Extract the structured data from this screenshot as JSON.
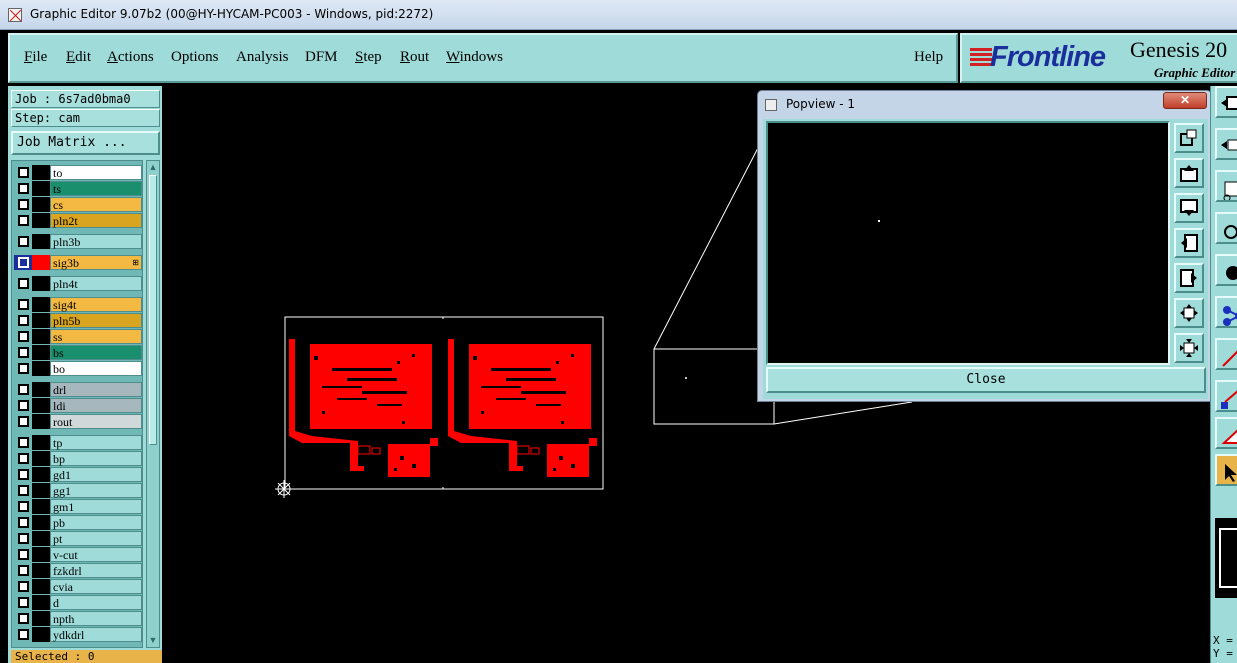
{
  "window": {
    "title": "Graphic Editor 9.07b2 (00@HY-HYCAM-PC003 - Windows, pid:2272)"
  },
  "menu": {
    "file": "File",
    "edit": "Edit",
    "actions": "Actions",
    "options": "Options",
    "analysis": "Analysis",
    "dfm": "DFM",
    "step": "Step",
    "rout": "Rout",
    "windows": "Windows",
    "help": "Help"
  },
  "brand": {
    "logo": "Frontline",
    "product": "Genesis 20",
    "subtitle": "Graphic Editor"
  },
  "left_panel": {
    "job": "Job : 6s7ad0bma0",
    "step": "Step: cam",
    "job_matrix": "Job Matrix ...",
    "selected": "Selected : 0"
  },
  "layers": [
    {
      "name": "to",
      "color": "#ffffff"
    },
    {
      "name": "ts",
      "color": "#1a8f6e"
    },
    {
      "name": "cs",
      "color": "#f4b942"
    },
    {
      "name": "pln2t",
      "color": "#d9a521"
    },
    {
      "name": "pln3b",
      "color": "#9fdbd9"
    },
    {
      "name": "sig3b",
      "color": "#f4b942",
      "work": true
    },
    {
      "name": "pln4t",
      "color": "#9fdbd9"
    },
    {
      "name": "sig4t",
      "color": "#f4b942"
    },
    {
      "name": "pln5b",
      "color": "#d9a521"
    },
    {
      "name": "ss",
      "color": "#f4b942"
    },
    {
      "name": "bs",
      "color": "#1a8f6e"
    },
    {
      "name": "bo",
      "color": "#ffffff"
    },
    {
      "name": "drl",
      "color": "#a6b7bd"
    },
    {
      "name": "ldi",
      "color": "#a6b7bd"
    },
    {
      "name": "rout",
      "color": "#d0d8da"
    },
    {
      "name": "tp",
      "color": "#9fdbd9"
    },
    {
      "name": "bp",
      "color": "#9fdbd9"
    },
    {
      "name": "gd1",
      "color": "#9fdbd9"
    },
    {
      "name": "gg1",
      "color": "#9fdbd9"
    },
    {
      "name": "gm1",
      "color": "#9fdbd9"
    },
    {
      "name": "pb",
      "color": "#9fdbd9"
    },
    {
      "name": "pt",
      "color": "#9fdbd9"
    },
    {
      "name": "v-cut",
      "color": "#9fdbd9"
    },
    {
      "name": "fzkdrl",
      "color": "#9fdbd9"
    },
    {
      "name": "cvia",
      "color": "#9fdbd9"
    },
    {
      "name": "d",
      "color": "#9fdbd9"
    },
    {
      "name": "npth",
      "color": "#9fdbd9"
    },
    {
      "name": "ydkdrl",
      "color": "#9fdbd9"
    }
  ],
  "popview": {
    "title": "Popview - 1",
    "close_label": "Close",
    "x_glyph": "✕"
  },
  "coords": {
    "x": "X =",
    "y": "Y ="
  },
  "colors": {
    "panel": "#9fdbd9",
    "board_copper": "#ff0000",
    "work_layer_marker": "#1b2f9c"
  }
}
